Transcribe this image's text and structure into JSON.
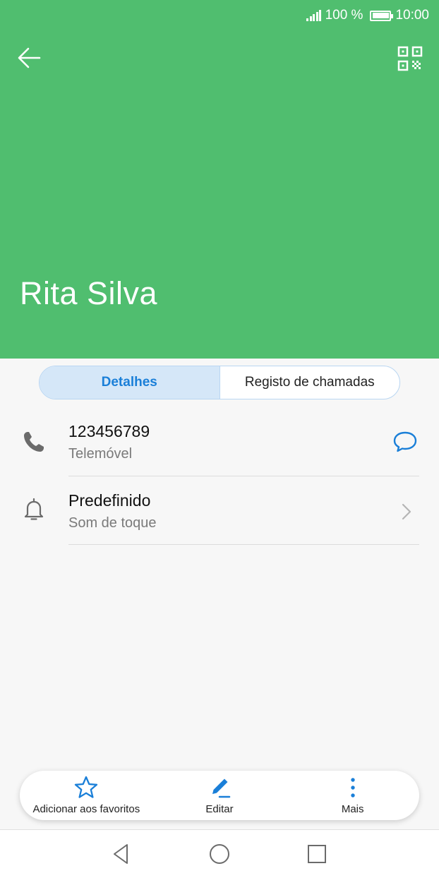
{
  "status_bar": {
    "battery": "100 %",
    "time": "10:00"
  },
  "colors": {
    "header": "#50be6f",
    "accent": "#1a7fd8"
  },
  "header": {
    "back_icon": "arrow-left-icon",
    "qr_icon": "qr-code-icon",
    "contact_name": "Rita Silva"
  },
  "tabs": [
    {
      "label": "Detalhes",
      "active": true
    },
    {
      "label": "Registo de chamadas",
      "active": false
    }
  ],
  "details": {
    "phone": {
      "number": "123456789",
      "type": "Telemóvel",
      "icon": "phone-icon",
      "action_icon": "message-bubble-icon"
    },
    "ringtone": {
      "value": "Predefinido",
      "label": "Som de toque",
      "icon": "bell-icon",
      "action_icon": "chevron-right-icon"
    }
  },
  "actions": [
    {
      "label": "Adicionar aos favoritos",
      "icon": "star-icon"
    },
    {
      "label": "Editar",
      "icon": "pencil-icon"
    },
    {
      "label": "Mais",
      "icon": "more-vertical-icon"
    }
  ],
  "nav": {
    "back_icon": "nav-back-icon",
    "home_icon": "nav-home-icon",
    "recents_icon": "nav-recents-icon"
  }
}
